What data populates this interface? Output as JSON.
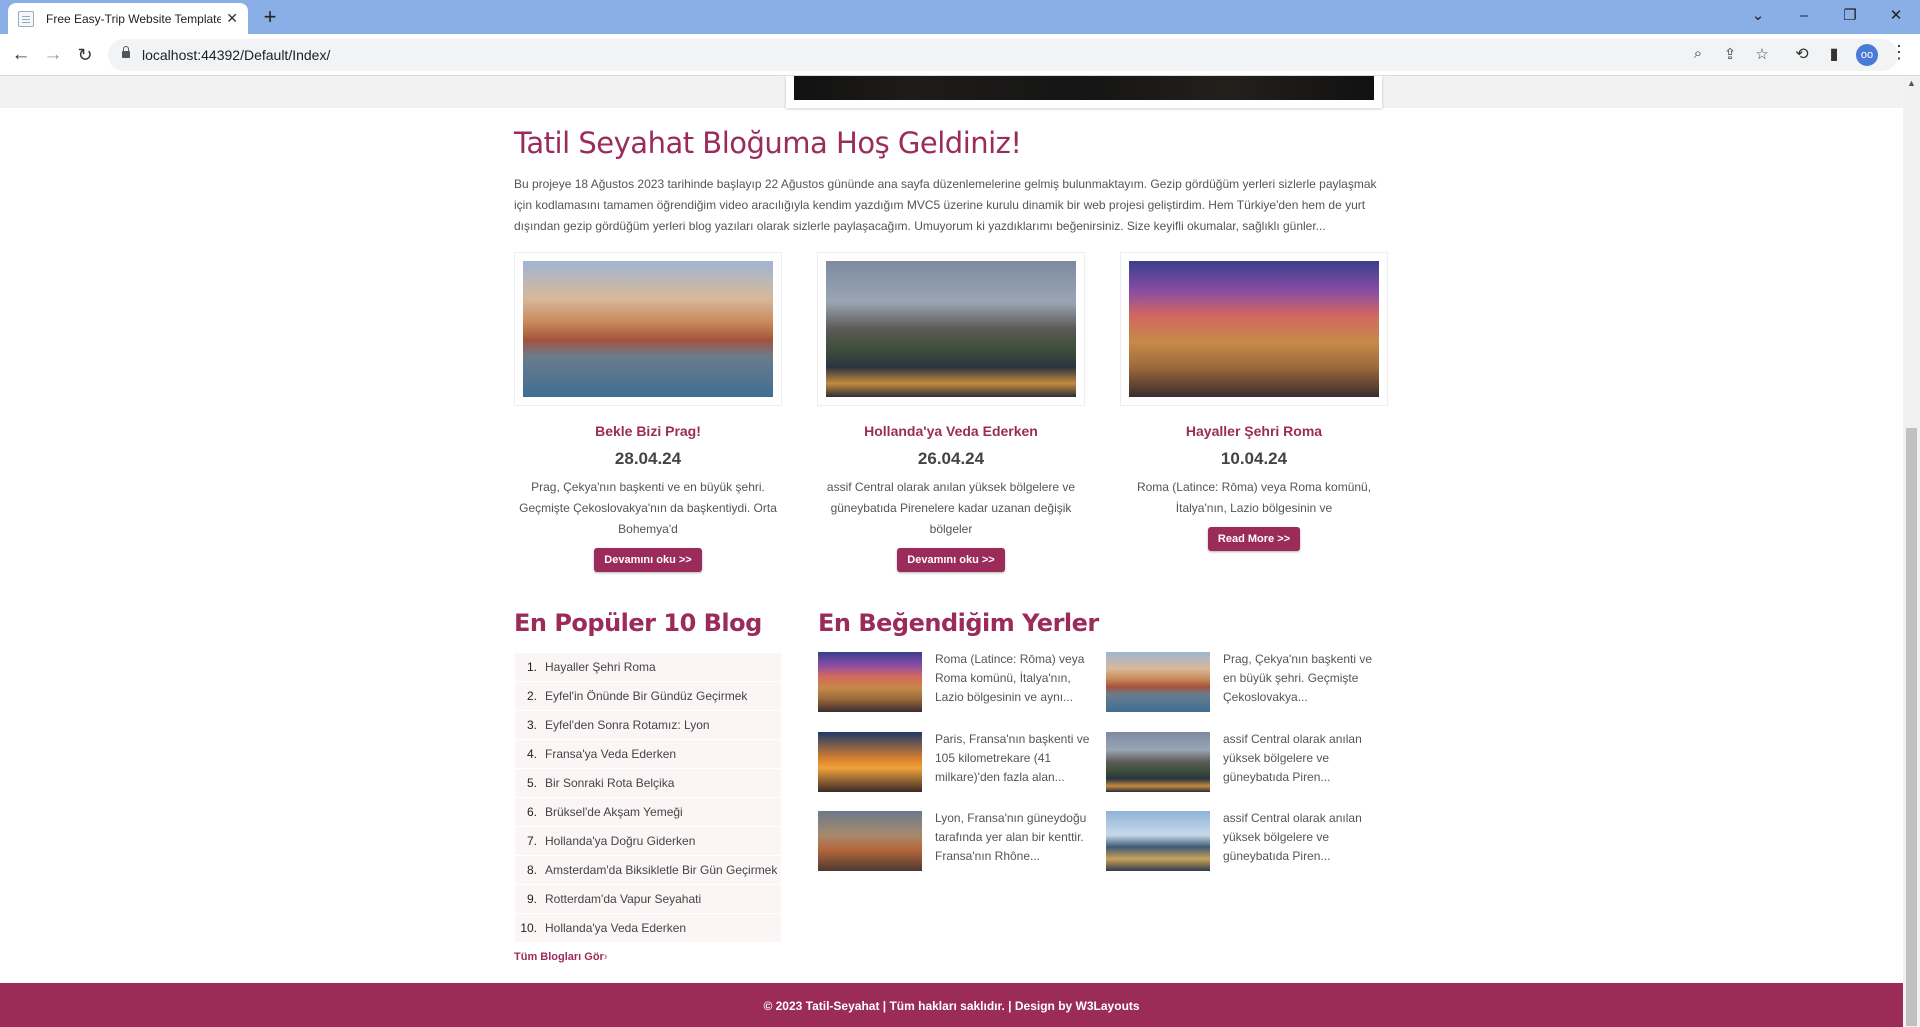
{
  "browser": {
    "tab_title": "Free Easy-Trip Website Template",
    "url": "localhost:44392/Default/Index/",
    "profile_initial": "oo"
  },
  "welcome": {
    "title": "Tatil Seyahat Bloğuma Hoş Geldiniz!",
    "text": "Bu projeye 18 Ağustos 2023 tarihinde başlayıp 22 Ağustos gününde ana sayfa düzenlemelerine gelmiş bulunmaktayım. Gezip gördüğüm yerleri sizlerle paylaşmak için kodlamasını tamamen öğrendiğim video aracılığıyla kendim yazdığım MVC5 üzerine kurulu dinamik bir web projesi geliştirdim. Hem Türkiye'den hem de yurt dışından gezip gördüğüm yerleri blog yazıları olarak sizlerle paylaşacağım. Umuyorum ki yazdıklarımı beğenirsiniz. Size keyifli okumalar, sağlıklı günler..."
  },
  "cards": [
    {
      "title": "Bekle Bizi Prag!",
      "date": "28.04.24",
      "text": "Prag, Çekya'nın başkenti ve en büyük şehri. Geçmişte Çekoslovakya'nın da başkentiydi. Orta Bohemya'd",
      "button": "Devamını oku >>",
      "image": "prague-photo"
    },
    {
      "title": "Hollanda'ya Veda Ederken",
      "date": "26.04.24",
      "text": "assif Central olarak anılan yüksek bölgelere ve güneybatıda Pirenelere kadar uzanan değişik bölgeler",
      "button": "Devamını oku >>",
      "image": "amsterdam-photo"
    },
    {
      "title": "Hayaller Şehri Roma",
      "date": "10.04.24",
      "text": "Roma (Latince: Rōma) veya Roma komünü, İtalya'nın, Lazio bölgesinin ve",
      "button": "Read More >>",
      "image": "rome-photo"
    }
  ],
  "popular": {
    "title": "En Popüler 10 Blog",
    "items": [
      {
        "num": "1.",
        "label": "Hayaller Şehri Roma"
      },
      {
        "num": "2.",
        "label": "Eyfel'in Önünde Bir Gündüz Geçirmek"
      },
      {
        "num": "3.",
        "label": "Eyfel'den Sonra Rotamız: Lyon"
      },
      {
        "num": "4.",
        "label": "Fransa'ya Veda Ederken"
      },
      {
        "num": "5.",
        "label": "Bir Sonraki Rota Belçika"
      },
      {
        "num": "6.",
        "label": "Brüksel'de Akşam Yemeği"
      },
      {
        "num": "7.",
        "label": "Hollanda'ya Doğru Giderken"
      },
      {
        "num": "8.",
        "label": "Amsterdam'da Biksikletle Bir Gün Geçirmek"
      },
      {
        "num": "9.",
        "label": "Rotterdam'da Vapur Seyahati"
      },
      {
        "num": "10.",
        "label": "Hollanda'ya Veda Ederken"
      }
    ],
    "all_link": "Tüm Blogları Gör"
  },
  "favorites": {
    "title": "En Beğendiğim Yerler",
    "items": [
      {
        "text": "Roma (Latince: Rōma) veya Roma komünü, İtalya'nın, Lazio bölgesinin ve aynı...",
        "image": "rome-photo"
      },
      {
        "text": "Prag, Çekya'nın başkenti ve en büyük şehri. Geçmişte Çekoslovakya...",
        "image": "prague-photo"
      },
      {
        "text": "Paris, Fransa'nın başkenti ve 105 kilometrekare (41 milkare)'den fazla alan...",
        "image": "paris-photo"
      },
      {
        "text": "assif Central olarak anılan yüksek bölgelere ve güneybatıda Piren...",
        "image": "amsterdam-photo"
      },
      {
        "text": "Lyon, Fransa'nın güneydoğu tarafında yer alan bir kenttir. Fransa'nın Rhône...",
        "image": "lyon-photo"
      },
      {
        "text": "assif Central olarak anılan yüksek bölgelere ve güneybatıda Piren...",
        "image": "rotterdam-photo"
      }
    ]
  },
  "footer": {
    "text": "© 2023 Tatil-Seyahat | Tüm hakları saklıdır. | Design by W3Layouts"
  },
  "colors": {
    "accent": "#9b2c5a",
    "tabbar": "#8aaee6"
  }
}
